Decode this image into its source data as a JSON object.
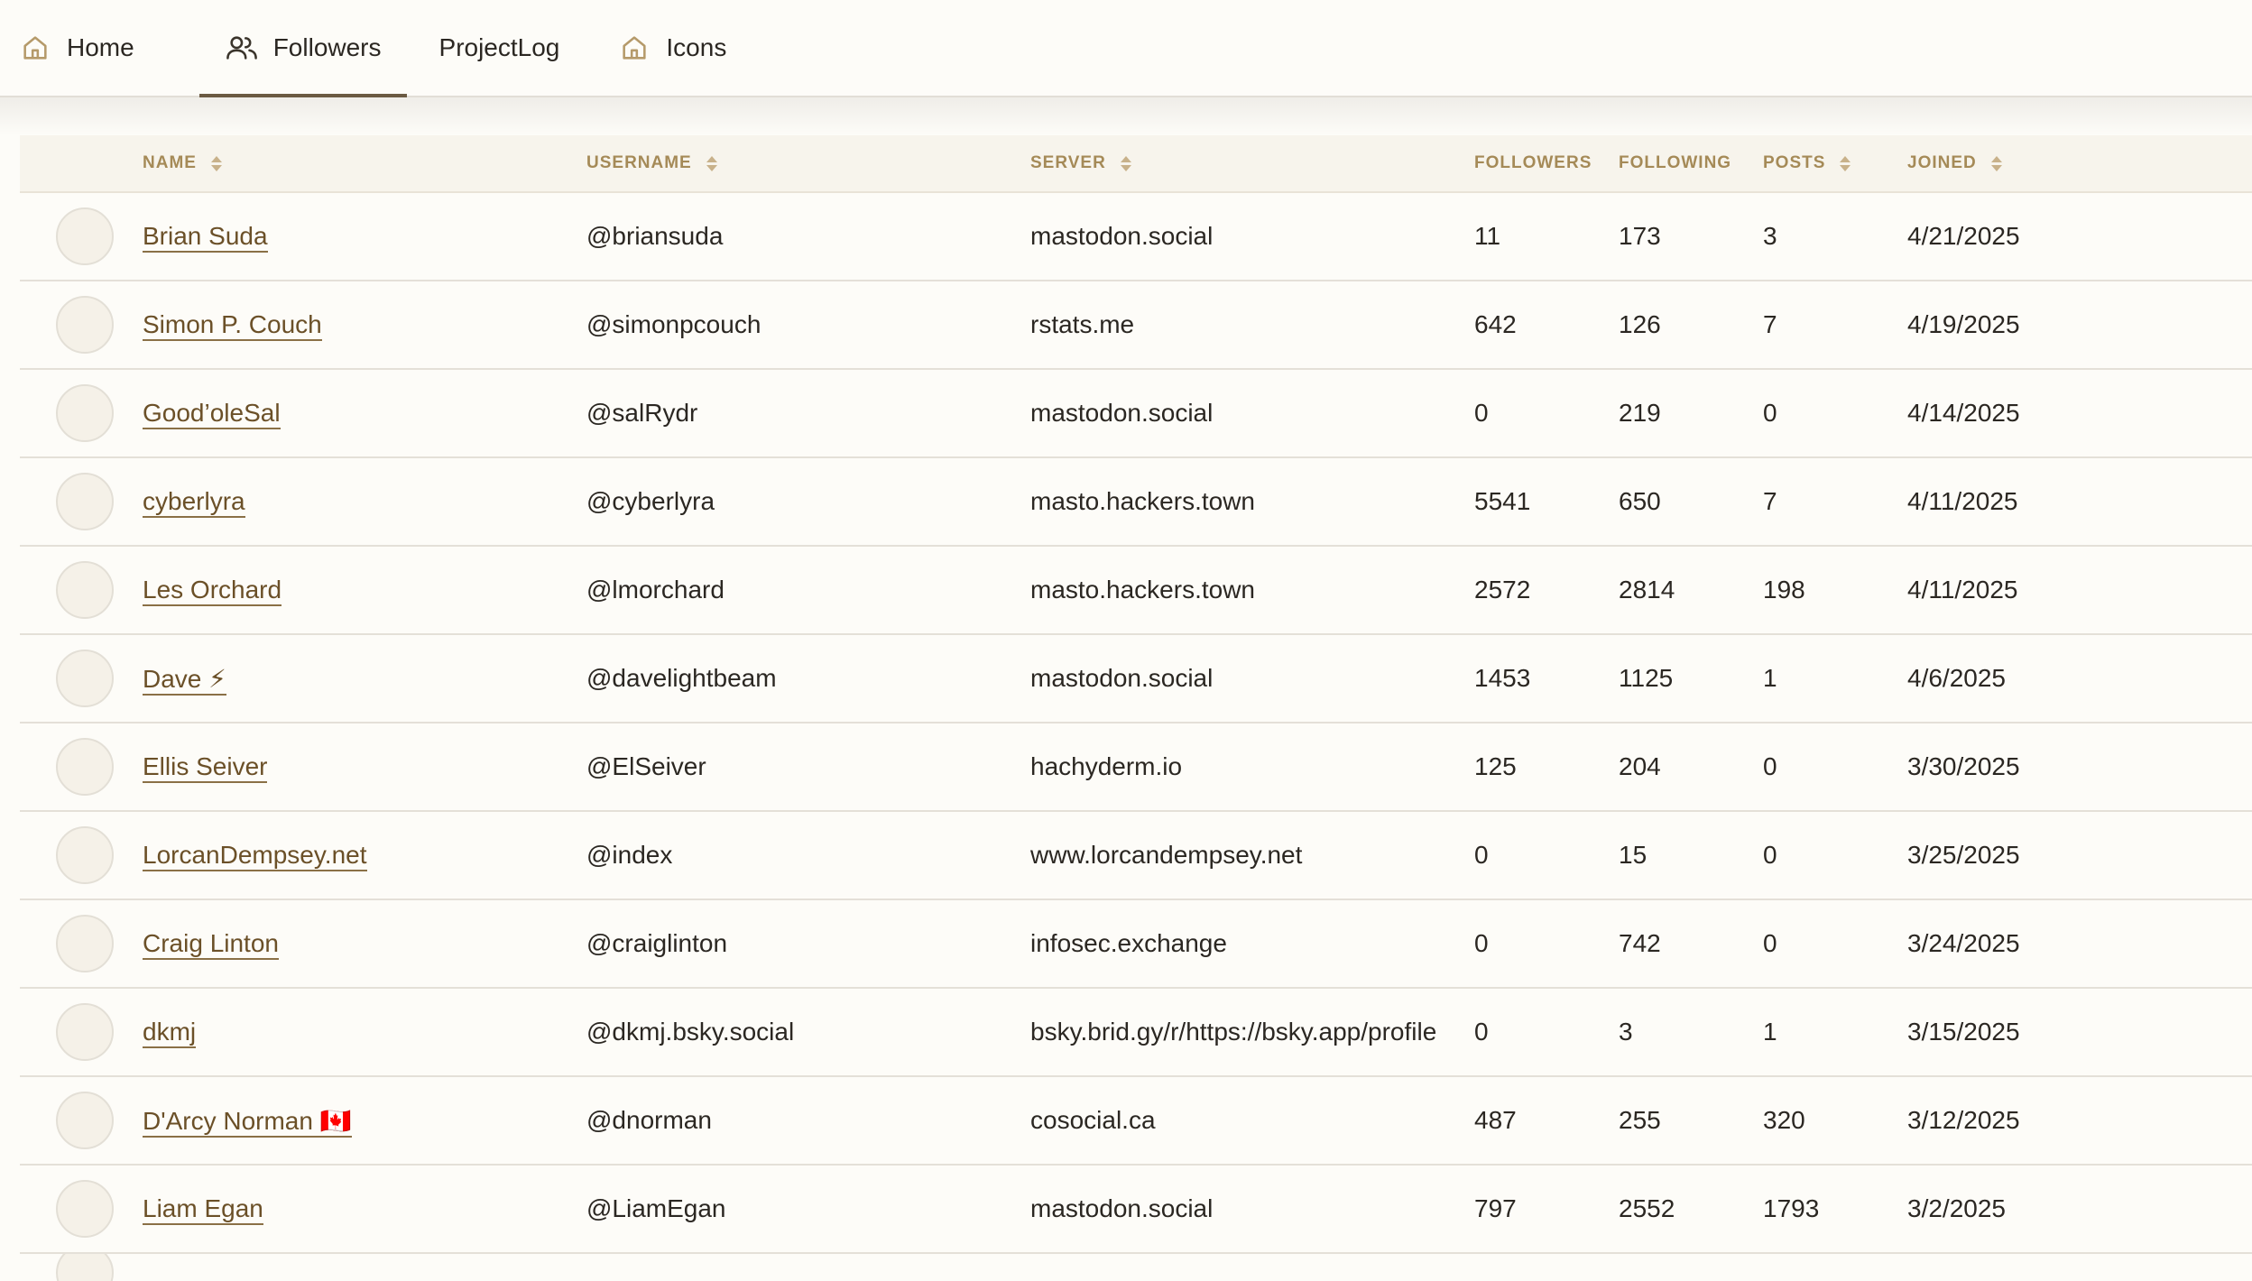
{
  "nav": {
    "tabs": [
      {
        "label": "Home",
        "icon": "home-icon"
      },
      {
        "label": "Followers",
        "icon": "users-icon"
      },
      {
        "label": "ProjectLog",
        "icon": ""
      },
      {
        "label": "Icons",
        "icon": "home-icon"
      }
    ],
    "active_tab": "Followers"
  },
  "colors": {
    "background": "#fdfcf8",
    "header_text": "#a58a57",
    "link": "#6b5028",
    "active_tab_underline": "#6b5a42"
  },
  "table": {
    "headers": {
      "name": "NAME",
      "username": "USERNAME",
      "server": "SERVER",
      "followers": "FOLLOWERS",
      "following": "FOLLOWING",
      "posts": "POSTS",
      "joined": "JOINED"
    },
    "rows": [
      {
        "name": "Brian Suda",
        "username": "@briansuda",
        "server": "mastodon.social",
        "followers": "11",
        "following": "173",
        "posts": "3",
        "joined": "4/21/2025"
      },
      {
        "name": "Simon P. Couch",
        "username": "@simonpcouch",
        "server": "rstats.me",
        "followers": "642",
        "following": "126",
        "posts": "7",
        "joined": "4/19/2025"
      },
      {
        "name": "Good’oleSal",
        "username": "@salRydr",
        "server": "mastodon.social",
        "followers": "0",
        "following": "219",
        "posts": "0",
        "joined": "4/14/2025"
      },
      {
        "name": "cyberlyra",
        "username": "@cyberlyra",
        "server": "masto.hackers.town",
        "followers": "5541",
        "following": "650",
        "posts": "7",
        "joined": "4/11/2025"
      },
      {
        "name": "Les Orchard",
        "username": "@lmorchard",
        "server": "masto.hackers.town",
        "followers": "2572",
        "following": "2814",
        "posts": "198",
        "joined": "4/11/2025"
      },
      {
        "name": "Dave ⚡",
        "username": "@davelightbeam",
        "server": "mastodon.social",
        "followers": "1453",
        "following": "1125",
        "posts": "1",
        "joined": "4/6/2025"
      },
      {
        "name": "Ellis Seiver",
        "username": "@ElSeiver",
        "server": "hachyderm.io",
        "followers": "125",
        "following": "204",
        "posts": "0",
        "joined": "3/30/2025"
      },
      {
        "name": "LorcanDempsey.net",
        "username": "@index",
        "server": "www.lorcandempsey.net",
        "followers": "0",
        "following": "15",
        "posts": "0",
        "joined": "3/25/2025"
      },
      {
        "name": "Craig Linton",
        "username": "@craiglinton",
        "server": "infosec.exchange",
        "followers": "0",
        "following": "742",
        "posts": "0",
        "joined": "3/24/2025"
      },
      {
        "name": "dkmj",
        "username": "@dkmj.bsky.social",
        "server": "bsky.brid.gy/r/https://bsky.app/profile",
        "followers": "0",
        "following": "3",
        "posts": "1",
        "joined": "3/15/2025"
      },
      {
        "name": "D'Arcy Norman 🇨🇦",
        "username": "@dnorman",
        "server": "cosocial.ca",
        "followers": "487",
        "following": "255",
        "posts": "320",
        "joined": "3/12/2025"
      },
      {
        "name": "Liam Egan",
        "username": "@LiamEgan",
        "server": "mastodon.social",
        "followers": "797",
        "following": "2552",
        "posts": "1793",
        "joined": "3/2/2025"
      }
    ]
  }
}
